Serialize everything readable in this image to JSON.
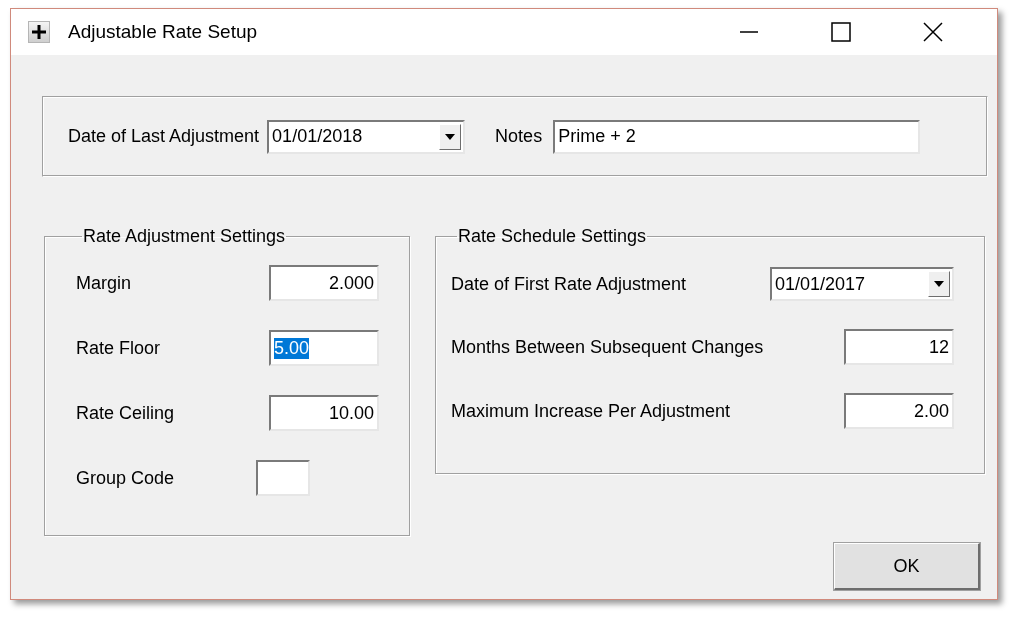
{
  "window": {
    "title": "Adjustable Rate Setup"
  },
  "header": {
    "last_adjustment": {
      "label": "Date of Last Adjustment",
      "value": "01/01/2018"
    },
    "notes": {
      "label": "Notes",
      "value": "Prime + 2"
    }
  },
  "rate_adjustment_settings": {
    "title": "Rate Adjustment Settings",
    "fields": [
      {
        "kind": "number",
        "label": "Margin",
        "value": "2.000",
        "selected": false
      },
      {
        "kind": "number",
        "label": "Rate Floor",
        "value": "5.00",
        "selected": true
      },
      {
        "kind": "number",
        "label": "Rate Ceiling",
        "value": "10.00",
        "selected": false
      },
      {
        "kind": "code",
        "label": "Group Code"
      }
    ]
  },
  "rate_schedule_settings": {
    "title": "Rate Schedule Settings",
    "fields": [
      {
        "kind": "date",
        "label": "Date of First Rate Adjustment",
        "value": "01/01/2017"
      },
      {
        "kind": "number",
        "label": "Months Between Subsequent Changes",
        "value": "12",
        "selected": false
      },
      {
        "kind": "number",
        "label": "Maximum Increase Per Adjustment",
        "value": "2.00",
        "selected": false
      }
    ]
  },
  "ok_button": {
    "label": "OK"
  }
}
